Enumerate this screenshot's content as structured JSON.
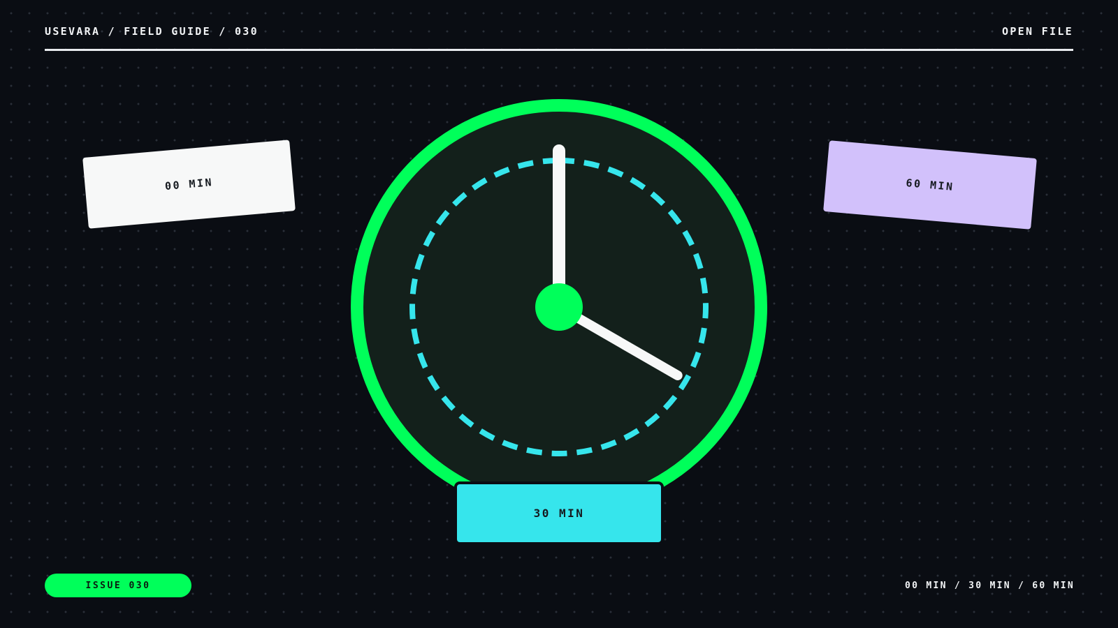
{
  "header": {
    "breadcrumb": "USEVARA / FIELD GUIDE / 030",
    "action_label": "OPEN FILE"
  },
  "cards": {
    "start": "00 MIN",
    "middle": "30 MIN",
    "end": "60 MIN"
  },
  "dial": {
    "minute_hand_minutes": 0,
    "second_hand_minutes": 20
  },
  "footer": {
    "issue": "ISSUE 030",
    "timeline": "00 MIN / 30 MIN / 60 MIN"
  },
  "colors": {
    "background": "#0a0d13",
    "green": "#00ff5a",
    "cyan": "#36e5ec",
    "lavender": "#d2c1fb",
    "white": "#f7f8f8"
  }
}
